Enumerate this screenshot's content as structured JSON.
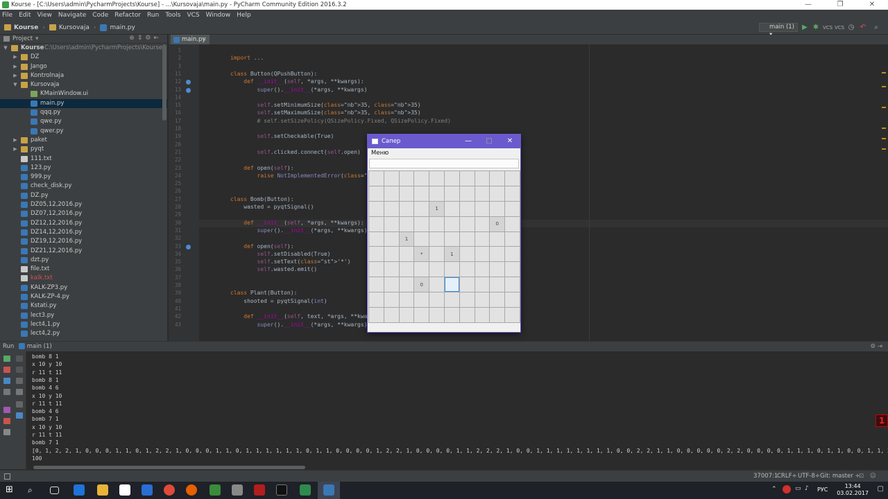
{
  "window": {
    "title": "Kourse - [C:\\Users\\admin\\PycharmProjects\\Kourse] - ...\\Kursovaja\\main.py - PyCharm Community Edition 2016.3.2"
  },
  "menu": [
    "File",
    "Edit",
    "View",
    "Navigate",
    "Code",
    "Refactor",
    "Run",
    "Tools",
    "VCS",
    "Window",
    "Help"
  ],
  "breadcrumbs": [
    "Kourse",
    "Kursovaja",
    "main.py"
  ],
  "run_config": "main (1)",
  "project_panel": {
    "header": "Project",
    "items": [
      {
        "label": "Kourse",
        "path": "C:\\Users\\admin\\PycharmProjects\\Kourse",
        "type": "folder",
        "depth": 0,
        "open": true
      },
      {
        "label": "DZ",
        "type": "folder",
        "depth": 1
      },
      {
        "label": "Jango",
        "type": "folder",
        "depth": 1
      },
      {
        "label": "Kontrolnaja",
        "type": "folder",
        "depth": 1
      },
      {
        "label": "Kursovaja",
        "type": "folder",
        "depth": 1,
        "open": true
      },
      {
        "label": "KMainWindow.ui",
        "type": "ui",
        "depth": 2
      },
      {
        "label": "main.py",
        "type": "py",
        "depth": 2,
        "selected": true
      },
      {
        "label": "qqq.py",
        "type": "py",
        "depth": 2
      },
      {
        "label": "qwe.py",
        "type": "py",
        "depth": 2
      },
      {
        "label": "qwer.py",
        "type": "py",
        "depth": 2
      },
      {
        "label": "paket",
        "type": "folder",
        "depth": 1
      },
      {
        "label": "pyqt",
        "type": "folder",
        "depth": 1
      },
      {
        "label": "111.txt",
        "type": "txt",
        "depth": 1
      },
      {
        "label": "123.py",
        "type": "py",
        "depth": 1
      },
      {
        "label": "999.py",
        "type": "py",
        "depth": 1
      },
      {
        "label": "check_disk.py",
        "type": "py",
        "depth": 1
      },
      {
        "label": "DZ.py",
        "type": "py",
        "depth": 1
      },
      {
        "label": "DZ05,12,2016.py",
        "type": "py",
        "depth": 1
      },
      {
        "label": "DZ07,12,2016.py",
        "type": "py",
        "depth": 1
      },
      {
        "label": "DZ12,12,2016.py",
        "type": "py",
        "depth": 1
      },
      {
        "label": "DZ14,12,2016.py",
        "type": "py",
        "depth": 1
      },
      {
        "label": "DZ19,12,2016.py",
        "type": "py",
        "depth": 1
      },
      {
        "label": "DZ21,12,2016.py",
        "type": "py",
        "depth": 1
      },
      {
        "label": "dzt.py",
        "type": "py",
        "depth": 1
      },
      {
        "label": "file.txt",
        "type": "txt",
        "depth": 1
      },
      {
        "label": "kalk.txt",
        "type": "txt",
        "depth": 1,
        "red": true
      },
      {
        "label": "KALK-ZP3.py",
        "type": "py",
        "depth": 1
      },
      {
        "label": "KALK-ZP-4.py",
        "type": "py",
        "depth": 1
      },
      {
        "label": "Kstati.py",
        "type": "py",
        "depth": 1
      },
      {
        "label": "lect3.py",
        "type": "py",
        "depth": 1
      },
      {
        "label": "lect4,1.py",
        "type": "py",
        "depth": 1
      },
      {
        "label": "lect4,2.py",
        "type": "py",
        "depth": 1
      }
    ]
  },
  "editor": {
    "tab": "main.py",
    "line_numbers": [
      "1",
      "2",
      "3",
      "11",
      "12",
      "13",
      "14",
      "15",
      "16",
      "17",
      "18",
      "19",
      "20",
      "21",
      "22",
      "23",
      "24",
      "25",
      "26",
      "27",
      "28",
      "29",
      "30",
      "31",
      "32",
      "33",
      "34",
      "35",
      "36",
      "37",
      "38",
      "39",
      "40",
      "41",
      "42",
      "43"
    ],
    "code": [
      "",
      "import ...",
      "",
      "class Button(QPushButton):",
      "    def __init__(self, *args, **kwargs):",
      "        super().__init__(*args, **kwargs)",
      "",
      "        self.setMinimumSize(35, 35)",
      "        self.setMaximumSize(35, 35)",
      "        # self.setSizePolicy(QSizePolicy.Fixed, QSizePolicy.Fixed)",
      "",
      "        self.setCheckable(True)",
      "",
      "        self.clicked.connect(self.open)",
      "",
      "    def open(self):",
      "        raise NotImplementedError('Не реализовано!')",
      "",
      "",
      "class Bomb(Button):",
      "    wasted = pyqtSignal()",
      "",
      "    def __init__(self, *args, **kwargs):",
      "        super().__init__(*args, **kwargs)",
      "",
      "    def open(self):",
      "        self.setDisabled(True)",
      "        self.setText('*')",
      "        self.wasted.emit()",
      "",
      "",
      "class Plant(Button):",
      "    shooted = pyqtSignal(int)",
      "",
      "    def __init__(self, text, *args, **kwargs):",
      "        super().__init__(*args, **kwargs)"
    ]
  },
  "run_panel": {
    "title": "Run",
    "config": "main (1)",
    "output": [
      "bomb 8 1",
      "x 10 y 10",
      "r 11 t 11",
      "bomb 8 1",
      "bomb 4 6",
      "x 10 y 10",
      "r 11 t 11",
      "bomb 4 6",
      "bomb 7 1",
      "x 10 y 10",
      "r 11 t 11",
      "bomb 7 1",
      "[0, 1, 2, 2, 1, 0, 0, 0, 1, 1, 0, 1, 2, 2, 1, 0, 0, 0, 1, 1, 0, 1, 1, 1, 1, 1, 1, 0, 1, 1, 0, 0, 0, 0, 1, 2, 2, 1, 0, 0, 0, 0, 1, 1, 2, 2, 2, 1, 0, 0, 1, 1, 1, 1, 1, 1, 1, 1, 0, 0, 2, 2, 1, 1, 0, 0, 0, 0, 0, 2, 2, 0, 0, 0, 0, 1, 1, 1, 0, 1, 1, 0, 0, 1, 1, 2, 2,",
      "100"
    ]
  },
  "statusbar": {
    "position": "37007:1",
    "line_sep": "CRLF÷",
    "encoding": "UTF-8÷",
    "git": "Git: master ÷"
  },
  "taskbar": {
    "lang": "РУС",
    "time": "13:44",
    "date": "03.02.2017"
  },
  "dialog": {
    "title": "Сапер",
    "menu": "Меню",
    "field_text": "",
    "grid_size": 10,
    "cells": [
      {
        "row": 2,
        "col": 4,
        "text": "1",
        "state": "open"
      },
      {
        "row": 3,
        "col": 8,
        "text": "0",
        "state": "open"
      },
      {
        "row": 4,
        "col": 2,
        "text": "1",
        "state": "open"
      },
      {
        "row": 5,
        "col": 3,
        "text": "*",
        "state": "open"
      },
      {
        "row": 5,
        "col": 5,
        "text": "1",
        "state": "open"
      },
      {
        "row": 7,
        "col": 3,
        "text": "0",
        "state": "open"
      },
      {
        "row": 7,
        "col": 5,
        "text": "",
        "state": "focus"
      }
    ]
  },
  "colors": {
    "ide_bg": "#2b2b2b",
    "panel_bg": "#3c3f41",
    "dialog_accent": "#6a5acd",
    "keyword": "#cc7832",
    "string": "#6a8759",
    "number": "#6897bb"
  }
}
